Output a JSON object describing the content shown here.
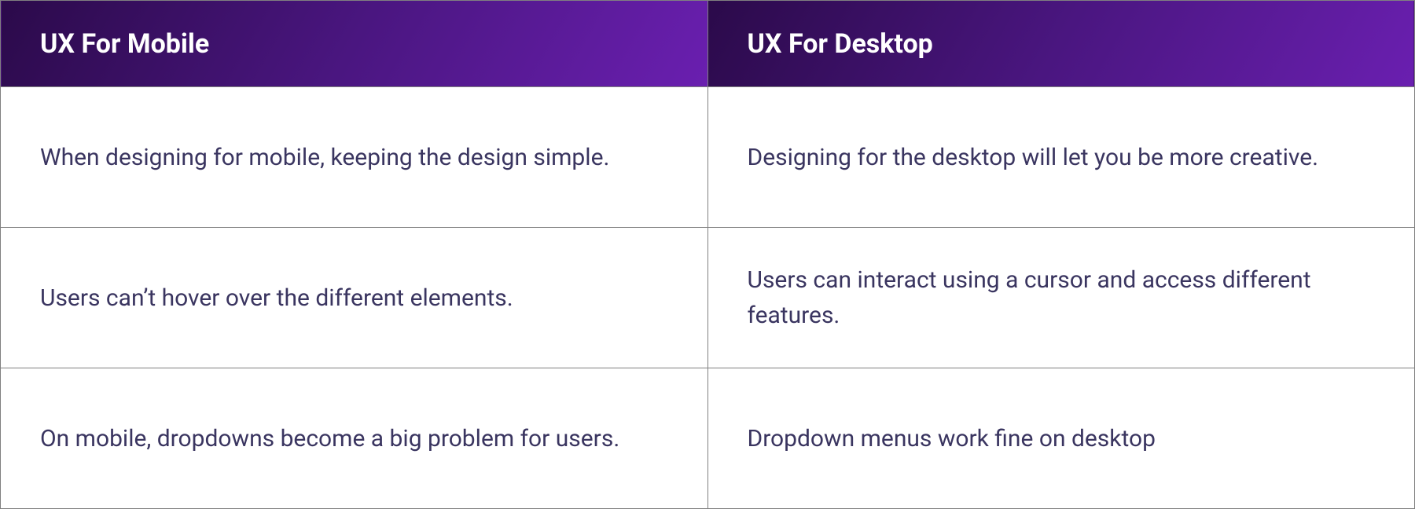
{
  "table": {
    "headers": {
      "mobile": "UX For Mobile",
      "desktop": "UX For Desktop"
    },
    "rows": [
      {
        "mobile": "When designing for mobile, keeping the design simple.",
        "desktop": "Designing for the desktop will let you be more creative."
      },
      {
        "mobile": "Users can’t hover over the different elements.",
        "desktop": "Users can interact using a cursor and access different features."
      },
      {
        "mobile": "On mobile, dropdowns become a big problem for users.",
        "desktop": "Dropdown menus work fine on desktop"
      }
    ]
  }
}
